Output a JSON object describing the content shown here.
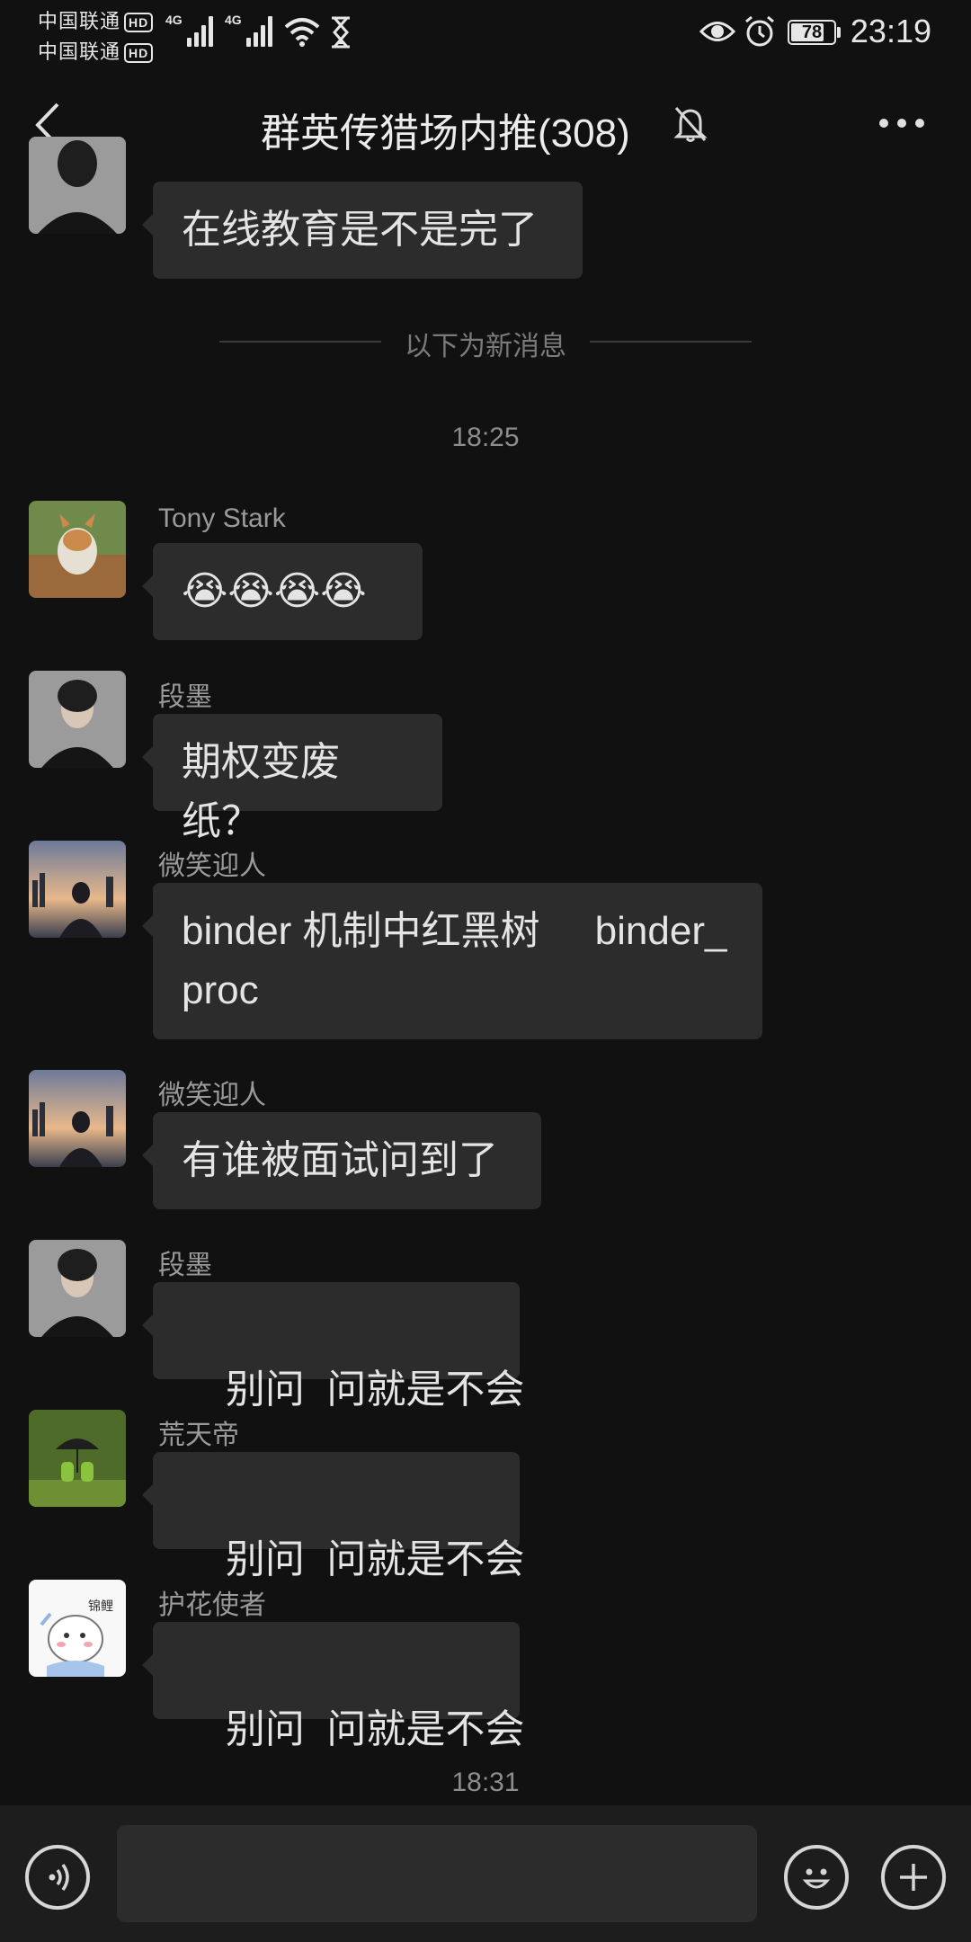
{
  "status_bar": {
    "carrier_1": "中国联通",
    "carrier_2": "中国联通",
    "hd_badge": "HD",
    "network_1": "4G",
    "network_2": "4G",
    "battery_level": 78,
    "battery_text": "78",
    "time": "23:19"
  },
  "header": {
    "title": "群英传猎场内推(308)",
    "icons": [
      "back-icon",
      "mute-bell-icon",
      "more-icon"
    ]
  },
  "messages": {
    "m0": {
      "text": "在线教育是不是完了"
    },
    "new_messages_label": "以下为新消息",
    "time_1": "18:25",
    "m1": {
      "sender": "Tony Stark",
      "text": "😭😭😭😭"
    },
    "m2": {
      "sender": "段墨",
      "text": "期权变废纸？"
    },
    "m3": {
      "sender": "微笑迎人",
      "line1": "binder 机制中红黑树     binder_",
      "line2": "proc"
    },
    "m4": {
      "sender": "微笑迎人",
      "text": "有谁被面试问到了"
    },
    "m5": {
      "sender": "段墨",
      "text": "别问  问就是不会"
    },
    "m6": {
      "sender": "荒天帝",
      "text": "别问  问就是不会"
    },
    "m7": {
      "sender": "护花使者",
      "text": "别问  问就是不会",
      "avatar_text": "锦鲤"
    },
    "time_2": "18:31"
  },
  "input_bar": {
    "input_value": "",
    "icons": [
      "voice-icon",
      "emoji-icon",
      "plus-icon"
    ]
  },
  "colors": {
    "background": "#111111",
    "bubble": "#2c2c2c",
    "input_bar": "#1d1d1d"
  }
}
